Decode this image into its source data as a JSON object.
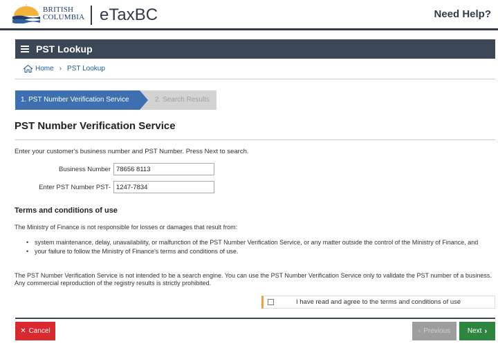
{
  "header": {
    "logo_line1": "BRITISH",
    "logo_line2": "COLUMBIA",
    "app_title": "eTaxBC",
    "help_label": "Need Help?"
  },
  "section": {
    "title": "PST Lookup"
  },
  "breadcrumb": {
    "home": "Home",
    "separator": "›",
    "current": "PST Lookup"
  },
  "stepper": {
    "step1": "1. PST Number Verification Service",
    "step2": "2. Search Results"
  },
  "page": {
    "title": "PST Number Verification Service",
    "instructions": "Enter your customer's business number and PST Number. Press Next to search."
  },
  "form": {
    "business_number_label": "Business Number",
    "business_number_value": "78656 8113",
    "pst_label": "Enter PST Number PST-",
    "pst_value": "1247-7834"
  },
  "terms": {
    "heading": "Terms and conditions of use",
    "intro": "The Ministry of Finance is not responsible for losses or damages that result from:",
    "bullets": [
      "system maintenance, delay, unavailability, or malfunction of the PST Number Verification Service, or any matter outside the control of the Ministry of Finance, and",
      "your failure to follow the Ministry of Finance's terms and conditions of use."
    ],
    "disclaimer": "The PST Number Verification Service is not intended to be a search engine. You can use the PST Number Verification Service only to validate the PST number of a business. Any commercial reproduction of the registry results is strictly prohibited.",
    "agree_label": "I have read and agree to the terms and conditions of use"
  },
  "buttons": {
    "cancel": "Cancel",
    "previous": "Previous",
    "next": "Next"
  },
  "colors": {
    "header_dark": "#3b4757",
    "step_active": "#3e6fb0",
    "cancel_red": "#d8292f",
    "next_green": "#2e8540",
    "link_blue": "#1a5a96"
  }
}
